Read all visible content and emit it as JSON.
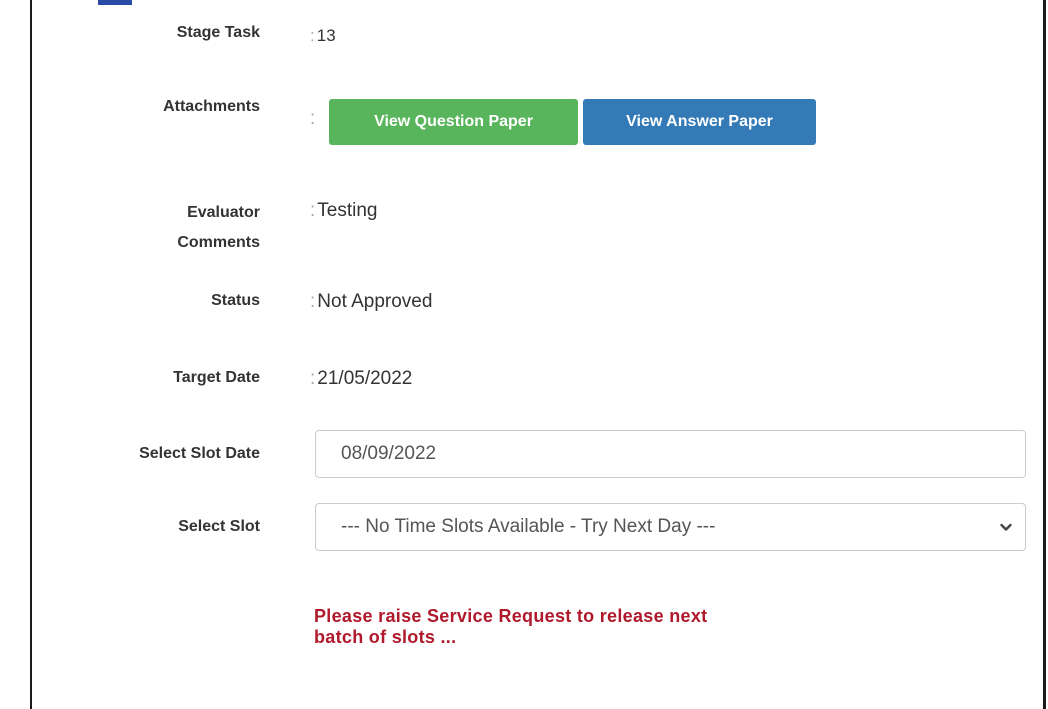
{
  "fields": {
    "stage_task": {
      "label": "Stage Task",
      "value": "13"
    },
    "attachments": {
      "label": "Attachments"
    },
    "evaluator_comments": {
      "label_line1": "Evaluator",
      "label_line2": "Comments",
      "value": "Testing"
    },
    "status": {
      "label": "Status",
      "value": "Not Approved"
    },
    "target_date": {
      "label": "Target Date",
      "value": "21/05/2022"
    },
    "slot_date": {
      "label": "Select Slot Date",
      "value": "08/09/2022"
    },
    "slot": {
      "label": "Select Slot",
      "selected": "--- No Time Slots Available - Try Next Day ---"
    }
  },
  "buttons": {
    "view_question": "View Question Paper",
    "view_answer": "View Answer Paper"
  },
  "warning": {
    "line1": "Please raise Service Request to release next",
    "line2": "batch of slots ..."
  },
  "colors": {
    "green_button": "#59b55b",
    "blue_button": "#337ab7",
    "warning_text": "#b0192b"
  },
  "icons": {
    "select_arrow": "chevron-down-icon"
  }
}
